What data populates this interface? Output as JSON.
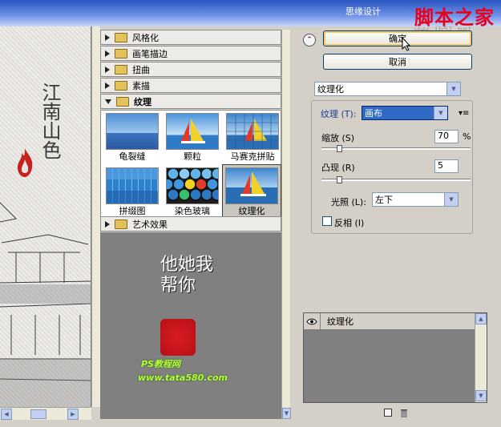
{
  "title_bar": {
    "title_text": "思缘设计",
    "watermark": "脚本之家",
    "watermark_url": "www.jb51.net"
  },
  "preview": {
    "calligraphy": "江南山色"
  },
  "gallery": {
    "categories": [
      {
        "label": "风格化",
        "expanded": false
      },
      {
        "label": "画笔描边",
        "expanded": false
      },
      {
        "label": "扭曲",
        "expanded": false
      },
      {
        "label": "素描",
        "expanded": false
      },
      {
        "label": "纹理",
        "expanded": true
      },
      {
        "label": "艺术效果",
        "expanded": false
      }
    ],
    "texture_filters": [
      {
        "label": "龟裂缝",
        "icon": "craquelure-thumb"
      },
      {
        "label": "颗粒",
        "icon": "grain-thumb"
      },
      {
        "label": "马赛克拼贴",
        "icon": "mosaic-tiles-thumb"
      },
      {
        "label": "拼缀图",
        "icon": "patchwork-thumb"
      },
      {
        "label": "染色玻璃",
        "icon": "stained-glass-thumb"
      },
      {
        "label": "纹理化",
        "icon": "texturizer-thumb",
        "selected": true
      }
    ],
    "stamp_text": "他她我帮你",
    "site_name": "PS教程网",
    "site_url": "www.tata580.com"
  },
  "panel": {
    "ok_label": "确定",
    "cancel_label": "取消",
    "filter_select": "纹理化",
    "texture_label": "纹理 (T):",
    "texture_value": "画布",
    "scale_label": "缩放 (S)",
    "scale_value": "70",
    "scale_unit": "%",
    "scale_fraction": 0.1,
    "relief_label": "凸现 (R)",
    "relief_value": "5",
    "relief_fraction": 0.1,
    "light_label": "光照 (L):",
    "light_value": "左下",
    "invert_label": "反相 (I)",
    "invert_checked": false
  },
  "layers": {
    "items": [
      {
        "name": "纹理化",
        "visible": true
      }
    ]
  },
  "colors": {
    "selection": "#316ac5",
    "watermark_red": "#e8001c",
    "site_green": "#b3ff3a"
  }
}
